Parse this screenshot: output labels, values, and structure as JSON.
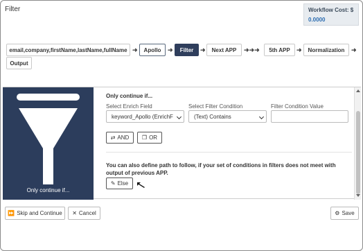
{
  "title": "Filter",
  "workflow_cost": {
    "label": "Workflow Cost: $",
    "value": "0.0000"
  },
  "flow": {
    "fields_node": "email,company,firstName,lastName,fullName",
    "apollo_node": "Apollo",
    "filter_node": "Filter",
    "next_app_node": "Next APP",
    "fifth_app_node": "5th APP",
    "normalization_node": "Normalization",
    "output_node": "Output",
    "arrow": "➜",
    "triple_arrow": "➜➜➜"
  },
  "funnel": {
    "caption": "Only continue if...",
    "color": "#2c3d5c"
  },
  "condition": {
    "heading": "Only continue if...",
    "enrich_field_label": "Select Enrich Field",
    "enrich_field_value": "keyword_Apollo (EnrichF",
    "filter_condition_label": "Select Filter Condition",
    "filter_condition_value": "(Text) Contains",
    "filter_value_label": "Filter Condition Value",
    "filter_value_value": "",
    "and_button": "AND",
    "or_button": "OR"
  },
  "else_section": {
    "text": "You can also define path to follow, if your set of conditions in filters does not meet with output of previous APP.",
    "else_button": "Else"
  },
  "footer": {
    "skip_button": "Skip and Continue",
    "cancel_button": "Cancel",
    "save_button": "Save"
  },
  "colors": {
    "accent": "#2f3e5c",
    "cost_value": "#2b6cb0"
  }
}
